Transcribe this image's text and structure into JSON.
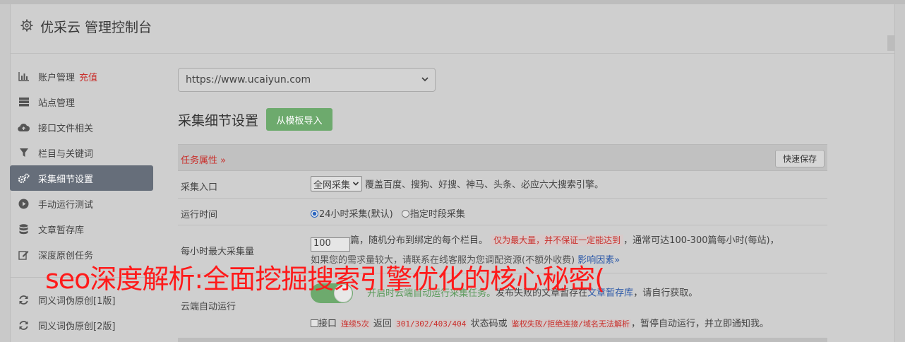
{
  "header": {
    "title": "优采云 管理控制台"
  },
  "sidebar": {
    "items": [
      {
        "label": "账户管理",
        "badge": "充值",
        "icon": "bar-chart-icon"
      },
      {
        "label": "站点管理",
        "icon": "server-icon"
      },
      {
        "label": "接口文件相关",
        "icon": "cloud-upload-icon"
      },
      {
        "label": "栏目与关键词",
        "icon": "filter-icon"
      },
      {
        "label": "采集细节设置",
        "icon": "gears-icon"
      },
      {
        "label": "手动运行测试",
        "icon": "play-icon"
      },
      {
        "label": "文章暂存库",
        "icon": "database-icon"
      },
      {
        "label": "深度原创任务",
        "icon": "edit-icon"
      },
      {
        "label": "同义词伪原创[1版]",
        "icon": "refresh-icon"
      },
      {
        "label": "同义词伪原创[2版]",
        "icon": "refresh-icon"
      }
    ]
  },
  "main": {
    "site_select": "https://www.ucaiyun.com",
    "section_title": "采集细节设置",
    "import_button": "从模板导入",
    "table": {
      "header_label": "任务属性 »",
      "quick_save": "快速保存",
      "rows": {
        "entry": {
          "label": "采集入口",
          "select_value": "全网采集",
          "desc": "覆盖百度、搜狗、好搜、神马、头条、必应六大搜索引擎。"
        },
        "runtime": {
          "label": "运行时间",
          "opt1": "24小时采集(默认)",
          "opt2": "指定时段采集"
        },
        "max": {
          "label": "每小时最大采集量",
          "value": "100",
          "text1": "篇，随机分布到绑定的每个栏目。",
          "tag": "仅为最大量，并不保证一定能达到",
          "text2": "，通常可达100-300篇每小时(每站)，",
          "line2": "如果您的需求量较大，请联系在线客服为您调配资源(不额外收费)",
          "line2_link": "影响因素»"
        },
        "cloud": {
          "label": "云端自动运行",
          "green": "开启时云端自动运行采集任务。",
          "text": "发布失败的文章暂存在",
          "link": "文章暂存库",
          "text_end": "，请自行获取。",
          "cb_label": "接口",
          "tag1": "连续5次",
          "t1": "返回",
          "codes": "301/302/403/404",
          "t2": "状态码或",
          "tag2": "鉴权失败/拒绝连接/域名无法解析",
          "t3": "，暂停自动运行，并立即通知我。"
        }
      }
    }
  },
  "overlay_text": "seo深度解析:全面挖掘搜索引擎优化的核心秘密(",
  "colors": {
    "active_nav": "#666e7a",
    "accent_green": "#6daa6d",
    "accent_red": "#c9302c",
    "overlay_red": "#ff1a1a"
  }
}
